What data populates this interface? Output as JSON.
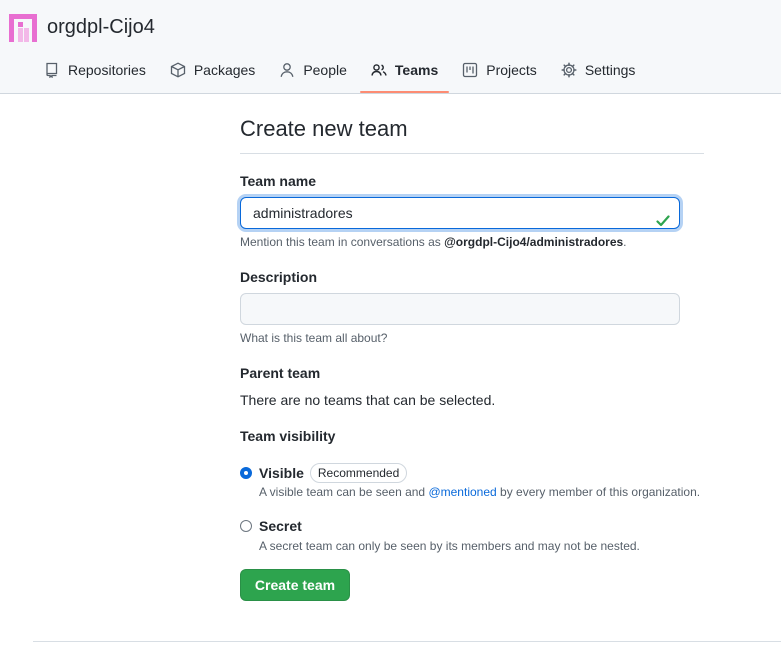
{
  "org": {
    "name": "orgdpl-Cijo4",
    "avatar_color": "#e86fd1"
  },
  "nav": {
    "items": [
      {
        "label": "Repositories",
        "icon": "repo-icon"
      },
      {
        "label": "Packages",
        "icon": "package-icon"
      },
      {
        "label": "People",
        "icon": "person-icon"
      },
      {
        "label": "Teams",
        "icon": "people-icon",
        "active": true
      },
      {
        "label": "Projects",
        "icon": "project-icon"
      },
      {
        "label": "Settings",
        "icon": "gear-icon"
      }
    ]
  },
  "form": {
    "title": "Create new team",
    "team_name": {
      "label": "Team name",
      "value": "administradores",
      "help_prefix": "Mention this team in conversations as ",
      "help_mention": "@orgdpl-Cijo4/administradores",
      "help_suffix": "."
    },
    "description": {
      "label": "Description",
      "value": "",
      "help": "What is this team all about?"
    },
    "parent_team": {
      "label": "Parent team",
      "text": "There are no teams that can be selected."
    },
    "visibility": {
      "label": "Team visibility",
      "visible": {
        "label": "Visible",
        "badge": "Recommended",
        "desc_prefix": "A visible team can be seen and ",
        "desc_mention": "@mentioned",
        "desc_suffix": " by every member of this organization.",
        "checked": true
      },
      "secret": {
        "label": "Secret",
        "desc": "A secret team can only be seen by its members and may not be nested.",
        "checked": false
      }
    },
    "submit_label": "Create team"
  },
  "colors": {
    "accent": "#0969da",
    "primary_button": "#2da44e",
    "active_tab_underline": "#fd8c73",
    "success_check": "#2da44e"
  }
}
